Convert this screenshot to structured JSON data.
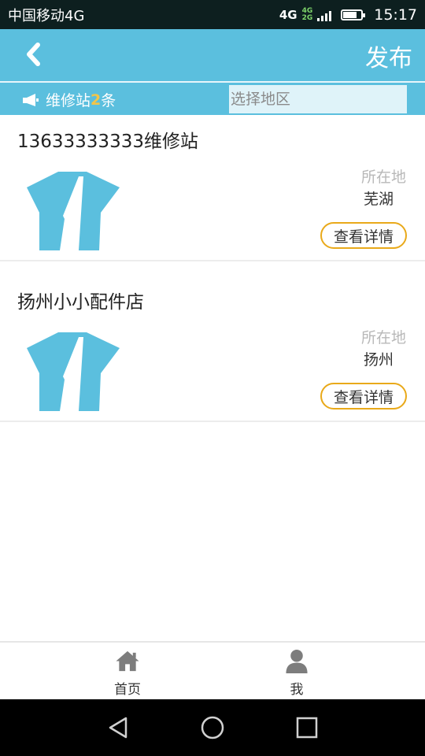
{
  "status_bar": {
    "carrier": "中国移动4G",
    "network_type": "4G",
    "secondary_networks": [
      "4G",
      "2G"
    ],
    "battery_level": 0.75,
    "time": "15:17"
  },
  "header": {
    "back_icon": "chevron-left-icon",
    "publish_label": "发布"
  },
  "sub_bar": {
    "icon": "megaphone-icon",
    "count_prefix": "维修站",
    "count": "2",
    "count_suffix": "条",
    "region_placeholder": "选择地区"
  },
  "listings": [
    {
      "title": "13633333333维修站",
      "location_label": "所在地",
      "location": "芜湖",
      "detail_label": "查看详情"
    },
    {
      "title": "扬州小小配件店",
      "location_label": "所在地",
      "location": "扬州",
      "detail_label": "查看详情"
    }
  ],
  "tabbar": {
    "home_label": "首页",
    "me_label": "我"
  },
  "colors": {
    "primary": "#5bbfde",
    "accent": "#e9a91a",
    "count_highlight": "#f3c548"
  }
}
